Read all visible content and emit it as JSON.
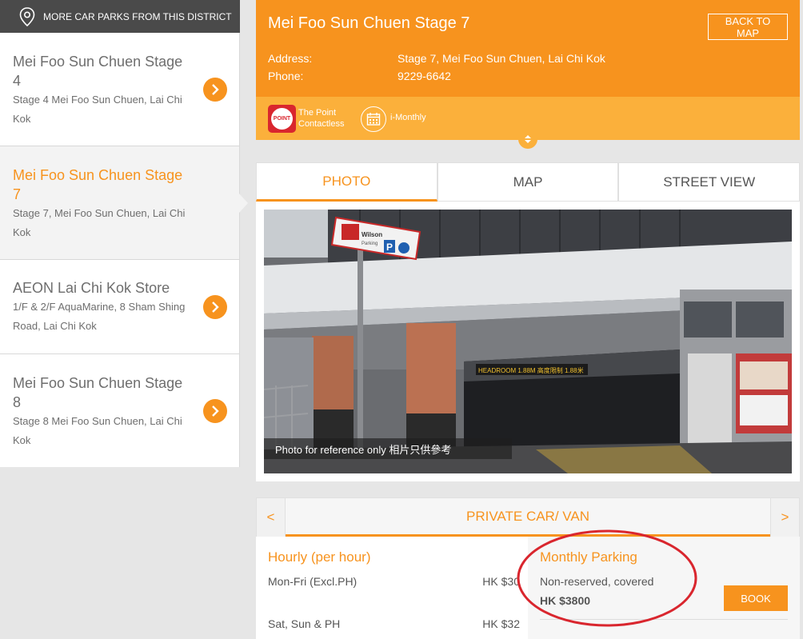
{
  "sidebar": {
    "more_label": "MORE CAR PARKS FROM THIS DISTRICT",
    "items": [
      {
        "name": "Mei Foo Sun Chuen Stage 4",
        "address": "Stage 4 Mei Foo Sun Chuen, Lai Chi Kok"
      },
      {
        "name": "Mei Foo Sun Chuen Stage 7",
        "address": "Stage 7, Mei Foo Sun Chuen, Lai Chi Kok"
      },
      {
        "name": "AEON Lai Chi Kok Store",
        "address": "1/F & 2/F AquaMarine, 8 Sham Shing Road, Lai Chi Kok"
      },
      {
        "name": "Mei Foo Sun Chuen Stage 8",
        "address": "Stage 8 Mei Foo Sun Chuen, Lai Chi Kok"
      }
    ]
  },
  "header": {
    "title": "Mei Foo Sun Chuen Stage 7",
    "back_label": "BACK TO MAP",
    "address_label": "Address:",
    "address_value": "Stage 7, Mei Foo Sun Chuen, Lai Chi Kok",
    "phone_label": "Phone:",
    "phone_value": "9229-6642"
  },
  "badges": {
    "point_icon_text": "POINT",
    "point_label_line1": "The Point",
    "point_label_line2": "Contactless",
    "monthly_label": "i-Monthly"
  },
  "tabs": [
    "PHOTO",
    "MAP",
    "STREET VIEW"
  ],
  "photo": {
    "caption": "Photo for reference only  相片只供參考",
    "sign_brand": "Wilson",
    "sign_sub": "Parking",
    "sign_p": "P",
    "headroom": "HEADROOM 1.88M  高度限制 1.88米"
  },
  "vehicle": {
    "prev": "<",
    "name": "PRIVATE CAR/ VAN",
    "next": ">"
  },
  "hourly": {
    "title": "Hourly (per hour)",
    "rows": [
      {
        "label": "Mon-Fri (Excl.PH)",
        "price": "HK $30"
      },
      {
        "label": "Sat, Sun & PH",
        "price": "HK $32"
      }
    ]
  },
  "monthly": {
    "title": "Monthly Parking",
    "desc": "Non-reserved, covered",
    "price": "HK $3800",
    "book_label": "BOOK"
  },
  "colors": {
    "accent": "#f7931e",
    "accent_light": "#fbb03b",
    "annotation": "#d9262e"
  }
}
